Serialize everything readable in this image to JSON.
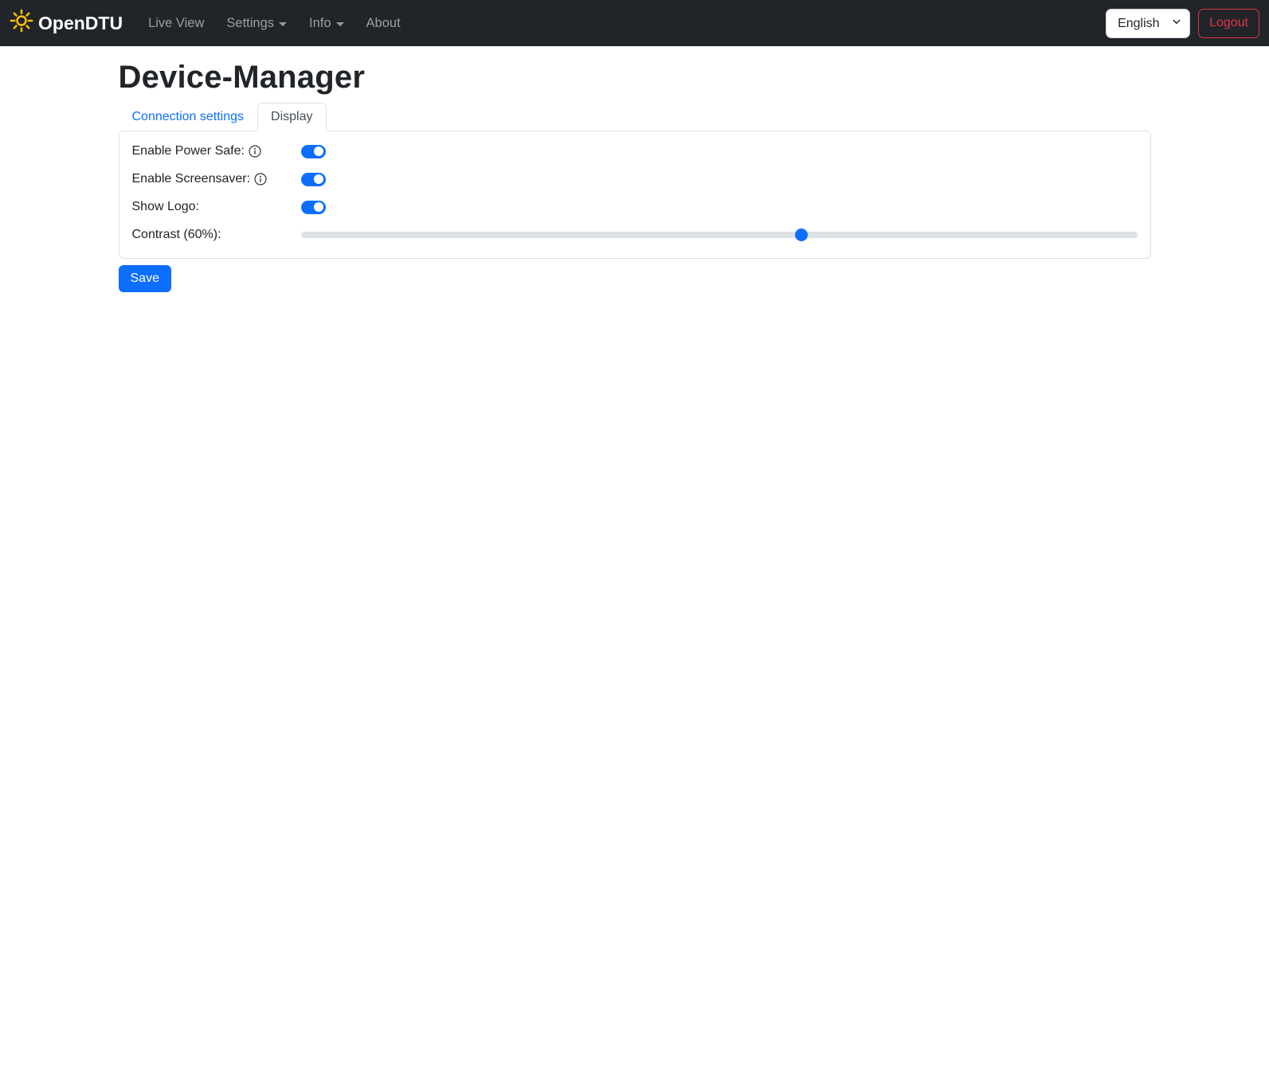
{
  "navbar": {
    "brand": "OpenDTU",
    "items": [
      {
        "label": "Live View",
        "dropdown": false
      },
      {
        "label": "Settings",
        "dropdown": true
      },
      {
        "label": "Info",
        "dropdown": true
      },
      {
        "label": "About",
        "dropdown": false
      }
    ],
    "language_selected": "English",
    "logout_label": "Logout"
  },
  "page": {
    "title": "Device-Manager"
  },
  "tabs": {
    "connection_settings": "Connection settings",
    "display": "Display"
  },
  "form": {
    "power_safe": {
      "label": "Enable Power Safe:",
      "enabled": true
    },
    "screensaver": {
      "label": "Enable Screensaver:",
      "enabled": true
    },
    "show_logo": {
      "label": "Show Logo:",
      "enabled": true
    },
    "contrast": {
      "label": "Contrast (60%):",
      "value": 60,
      "min": 0,
      "max": 100
    }
  },
  "actions": {
    "save_label": "Save"
  },
  "colors": {
    "primary": "#0d6efd",
    "navbar_bg": "#212529",
    "logout_red": "#dc3545",
    "brand_icon_yellow": "#ffc107",
    "border": "#dee2e6",
    "track": "#dee2e6"
  }
}
